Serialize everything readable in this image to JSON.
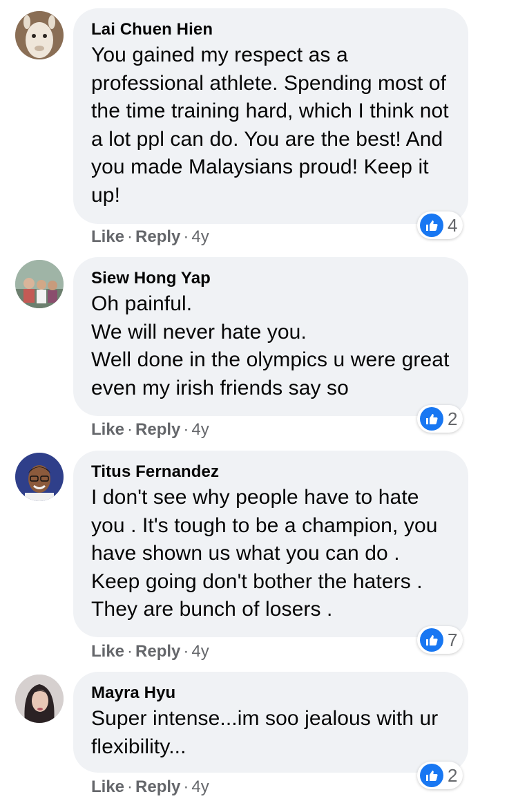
{
  "colors": {
    "bubble": "#f0f2f5",
    "like_blue": "#1877f2",
    "meta_gray": "#65676b",
    "text": "#050505"
  },
  "comments": [
    {
      "author": "Lai Chuen Hien",
      "avatar_icon": "llama-avatar",
      "text": "You gained my respect as a professional athlete. Spending most of the time training hard, which I think not a lot ppl can do. You are the best! And you made Malaysians proud! Keep it up!",
      "reaction_icon": "like-icon",
      "reaction_count": "4",
      "like_label": "Like",
      "reply_label": "Reply",
      "age": "4y"
    },
    {
      "author": "Siew Hong Yap",
      "avatar_icon": "group-photo-avatar",
      "text": "Oh painful.\nWe will never hate you.\nWell done in the olympics u were great even my irish friends say so",
      "reaction_icon": "like-icon",
      "reaction_count": "2",
      "like_label": "Like",
      "reply_label": "Reply",
      "age": "4y"
    },
    {
      "author": "Titus Fernandez",
      "avatar_icon": "man-glasses-avatar",
      "text": "I don't see why people have to hate you . It's tough to be a champion, you have shown us what you can do . Keep going don't bother the haters . They are bunch of losers .",
      "reaction_icon": "like-icon",
      "reaction_count": "7",
      "like_label": "Like",
      "reply_label": "Reply",
      "age": "4y"
    },
    {
      "author": "Mayra Hyu",
      "avatar_icon": "woman-portrait-avatar",
      "text": "Super intense...im soo jealous with ur flexibility...",
      "reaction_icon": "like-icon",
      "reaction_count": "2",
      "like_label": "Like",
      "reply_label": "Reply",
      "age": "4y"
    }
  ]
}
